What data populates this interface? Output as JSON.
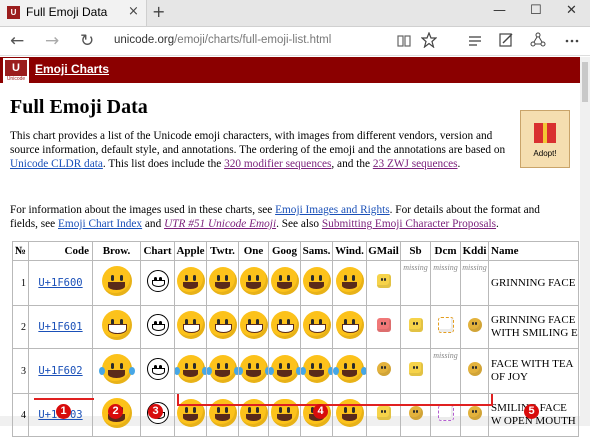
{
  "browser": {
    "tab_title": "Full Emoji Data",
    "tab_close": "×",
    "new_tab": "+",
    "window_buttons": [
      "—",
      "☐",
      "✕"
    ],
    "url_host": "unicode.org",
    "url_path": "/emoji/charts/full-emoji-list.html",
    "nav": {
      "back": "←",
      "forward": "→",
      "refresh": "↻"
    },
    "toolbar_icons": [
      "reading-view-icon",
      "favorite-star-icon",
      "hub-icon",
      "web-note-icon",
      "share-icon",
      "more-icon"
    ]
  },
  "header": {
    "logo_text": "U",
    "logo_sub": "Unicode",
    "link": "Emoji Charts",
    "color": "#8b0000"
  },
  "page": {
    "title": "Full Emoji Data",
    "intro": {
      "t1": "This chart provides a list of the Unicode emoji characters, with images from different vendors, version and source information, default style, and annotations. The ordering of the emoji and the annotations are based on ",
      "l1": "Unicode CLDR data",
      "t2": ". This list does include the ",
      "l2": "320 modifier sequences",
      "t3": ", and the ",
      "l3": "23 ZWJ sequences",
      "t4": "."
    },
    "info": {
      "t1": "For information about the images used in these charts, see ",
      "l1": "Emoji Images and Rights",
      "t2": ". For details about the format and fields, see ",
      "l2": "Emoji Chart Index",
      "t3": " and ",
      "l3": "UTR #51 Unicode Emoji",
      "t4": ". See also ",
      "l4": "Submitting Emoji Character Proposals",
      "t5": "."
    },
    "gift_label": "Adopt!"
  },
  "table": {
    "headers": [
      "№",
      "Code",
      "Brow.",
      "Chart",
      "Apple",
      "Twtr.",
      "One",
      "Goog",
      "Sams.",
      "Wind.",
      "GMail",
      "Sb",
      "Dcm",
      "Kddi",
      "Name"
    ],
    "missing_label": "missing",
    "rows": [
      {
        "num": "1",
        "code": "U+1F600",
        "name": "GRINNING FACE",
        "missing": [
          "sb",
          "dcm",
          "kddi"
        ]
      },
      {
        "num": "2",
        "code": "U+1F601",
        "name": "GRINNING FACE WITH SMILING E",
        "missing": []
      },
      {
        "num": "3",
        "code": "U+1F602",
        "name": "FACE WITH TEA OF JOY",
        "missing": [
          "dcm"
        ]
      },
      {
        "num": "4",
        "code": "U+1F603",
        "name": "SMILING FACE W OPEN MOUTH",
        "missing": []
      }
    ]
  },
  "annotations": [
    "1",
    "2",
    "3",
    "4",
    "5"
  ],
  "colors": {
    "annotation": "#d80c0c",
    "link": "#1a50b8",
    "visited": "#7a1f7a",
    "emoji_yellow": "#fcc21b"
  }
}
